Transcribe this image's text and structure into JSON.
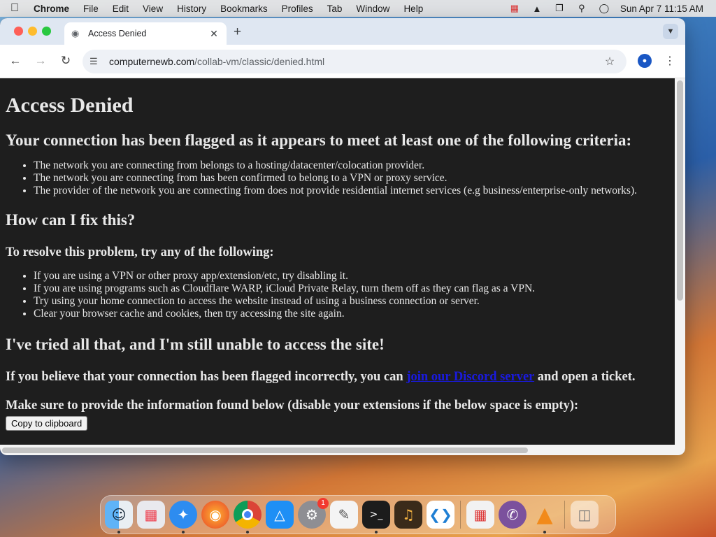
{
  "menubar": {
    "app_name": "Chrome",
    "items": [
      "File",
      "Edit",
      "View",
      "History",
      "Bookmarks",
      "Profiles",
      "Tab",
      "Window",
      "Help"
    ],
    "clock": "Sun Apr 7  11:15 AM"
  },
  "browser": {
    "tab_title": "Access Denied",
    "url_host": "computernewb.com",
    "url_path": "/collab-vm/classic/denied.html"
  },
  "page": {
    "title": "Access Denied",
    "flagged_heading": "Your connection has been flagged as it appears to meet at least one of the following criteria:",
    "criteria": [
      "The network you are connecting from belongs to a hosting/datacenter/colocation provider.",
      "The network you are connecting from has been confirmed to belong to a VPN or proxy service.",
      "The provider of the network you are connecting from does not provide residential internet services (e.g business/enterprise-only networks)."
    ],
    "fix_heading": "How can I fix this?",
    "resolve_heading": "To resolve this problem, try any of the following:",
    "fixes": [
      "If you are using a VPN or other proxy app/extension/etc, try disabling it.",
      "If you are using programs such as Cloudflare WARP, iCloud Private Relay, turn them off as they can flag as a VPN.",
      "Try using your home connection to access the website instead of using a business connection or server.",
      "Clear your browser cache and cookies, then try accessing the site again."
    ],
    "tried_heading": "I've tried all that, and I'm still unable to access the site!",
    "incorrect_prefix": "If you believe that your connection has been flagged incorrectly, you can ",
    "discord_link": "join our Discord server",
    "incorrect_suffix": " and open a ticket.",
    "provide_info": "Make sure to provide the information found below (disable your extensions if the below space is empty):",
    "copy_button": "Copy to clipboard"
  },
  "dock": {
    "notification_badge": "1"
  },
  "colors": {
    "page_bg": "#1e1e1e",
    "page_text": "#e8e8e8",
    "link": "#1a1adf"
  }
}
